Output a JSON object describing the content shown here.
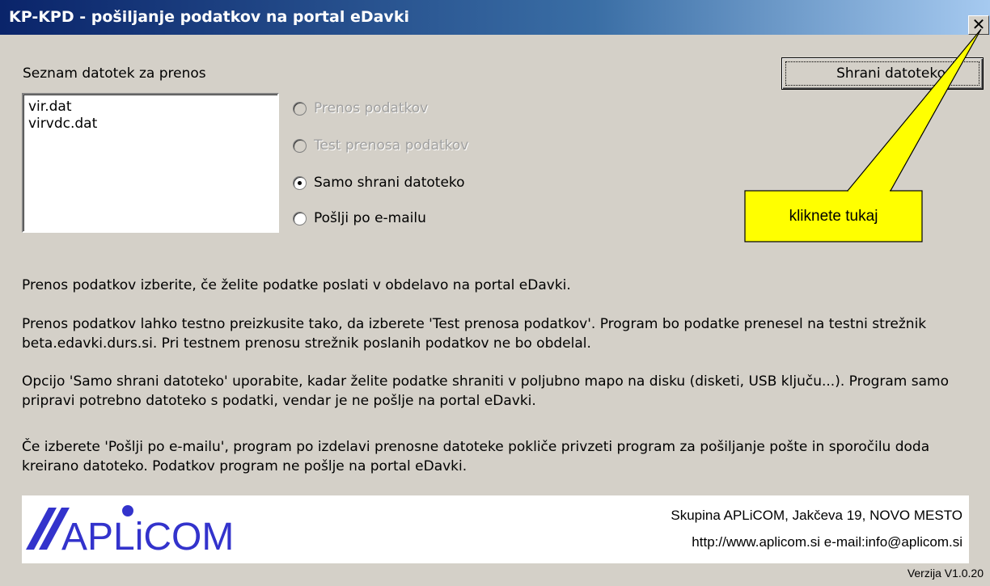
{
  "window": {
    "title": "KP-KPD - pošiljanje podatkov na portal eDavki",
    "close_label": "✕"
  },
  "files": {
    "label": "Seznam datotek za prenos",
    "items": [
      "vir.dat",
      "virvdc.dat"
    ]
  },
  "options": [
    {
      "label": "Prenos podatkov",
      "enabled": false,
      "selected": false
    },
    {
      "label": "Test prenosa podatkov",
      "enabled": false,
      "selected": false
    },
    {
      "label": "Samo shrani datoteko",
      "enabled": true,
      "selected": true
    },
    {
      "label": "Pošlji po e-mailu",
      "enabled": true,
      "selected": false
    }
  ],
  "save_button": {
    "label": "Shrani datoteko"
  },
  "callout": {
    "text": "kliknete tukaj",
    "color": "#ffff00"
  },
  "descriptions": [
    "Prenos podatkov izberite, če želite podatke poslati v obdelavo na portal eDavki.",
    "Prenos podatkov lahko testno preizkusite tako, da izberete 'Test prenosa podatkov'. Program bo podatke prenesel na testni strežnik beta.edavki.durs.si. Pri testnem prenosu strežnik poslanih podatkov ne bo obdelal.",
    "Opcijo 'Samo shrani datoteko' uporabite, kadar želite podatke shraniti v poljubno mapo na disku (disketi, USB ključu...). Program samo pripravi potrebno datoteko s podatki, vendar je ne pošlje na portal eDavki.",
    "Če izberete 'Pošlji po e-mailu', program po izdelavi prenosne datoteke pokliče privzeti program za pošiljanje pošte in sporočilu doda kreirano datoteko. Podatkov program ne pošlje na portal eDavki."
  ],
  "footer": {
    "logo_text": "APLiCOM",
    "company": "Skupina APLiCOM, Jakčeva 19, NOVO MESTO",
    "contact": "http://www.aplicom.si  e-mail:info@aplicom.si",
    "version": "Verzija V1.0.20",
    "brand_color": "#3333cc"
  }
}
